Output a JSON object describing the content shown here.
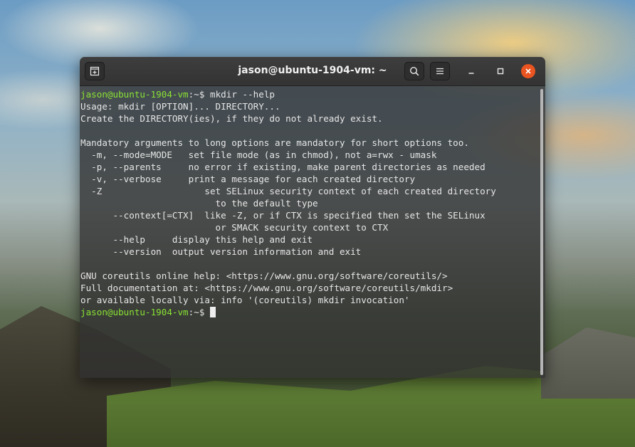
{
  "window": {
    "title": "jason@ubuntu-1904-vm: ~"
  },
  "icons": {
    "new_tab": "new-tab-icon",
    "search": "search-icon",
    "menu": "hamburger-menu-icon",
    "minimize": "minimize-icon",
    "maximize": "maximize-icon",
    "close": "close-icon"
  },
  "colors": {
    "prompt": "#8ae234",
    "close_button": "#e95420",
    "terminal_text": "#e6e6e6"
  },
  "terminal": {
    "prompt_user": "jason@ubuntu-1904-vm",
    "prompt_suffix": ":~$ ",
    "command": "mkdir --help",
    "output": [
      "Usage: mkdir [OPTION]... DIRECTORY...",
      "Create the DIRECTORY(ies), if they do not already exist.",
      "",
      "Mandatory arguments to long options are mandatory for short options too.",
      "  -m, --mode=MODE   set file mode (as in chmod), not a=rwx - umask",
      "  -p, --parents     no error if existing, make parent directories as needed",
      "  -v, --verbose     print a message for each created directory",
      "  -Z                   set SELinux security context of each created directory",
      "                         to the default type",
      "      --context[=CTX]  like -Z, or if CTX is specified then set the SELinux",
      "                         or SMACK security context to CTX",
      "      --help     display this help and exit",
      "      --version  output version information and exit",
      "",
      "GNU coreutils online help: <https://www.gnu.org/software/coreutils/>",
      "Full documentation at: <https://www.gnu.org/software/coreutils/mkdir>",
      "or available locally via: info '(coreutils) mkdir invocation'"
    ]
  }
}
